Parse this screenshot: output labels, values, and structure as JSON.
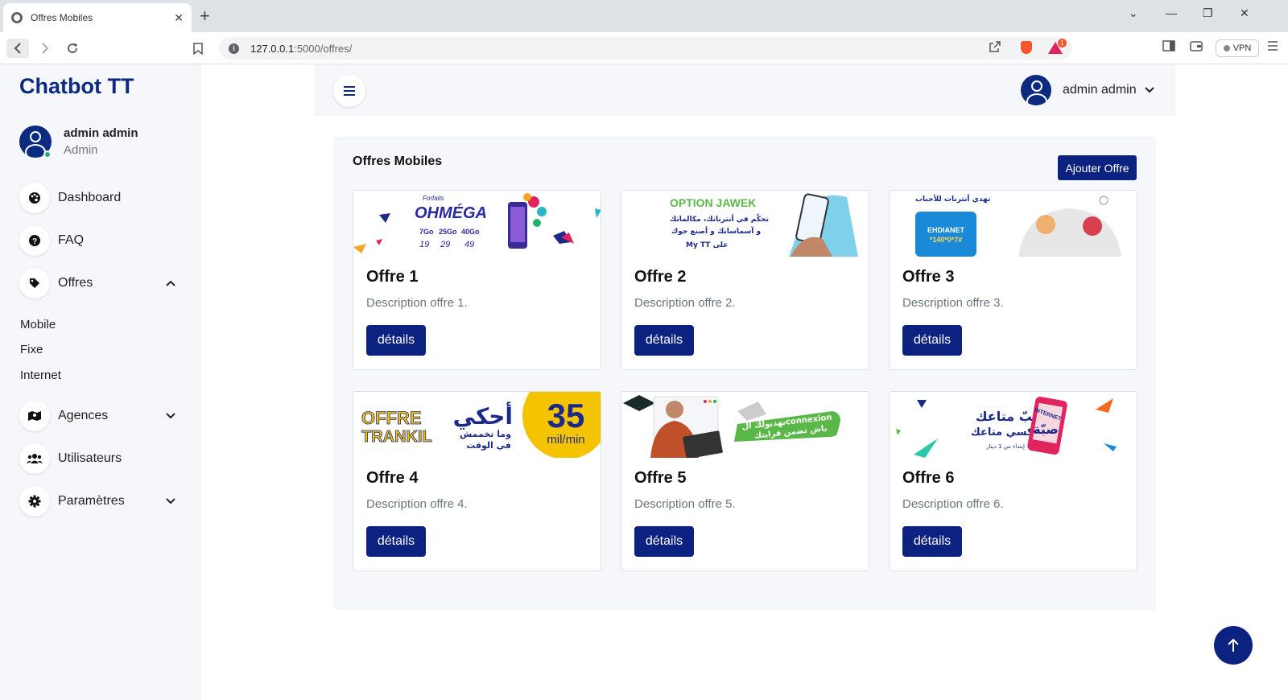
{
  "browser": {
    "tab_title": "Offres Mobiles",
    "tab_close": "✕",
    "new_tab": "+",
    "url_host": "127.0.0.1",
    "url_path": ":5000/offres/",
    "vpn_label": "VPN",
    "rewards_count": "1"
  },
  "sidebar": {
    "brand": "Chatbot TT",
    "user_name": "admin admin",
    "user_role": "Admin",
    "items": [
      {
        "label": "Dashboard",
        "icon": "palette-icon"
      },
      {
        "label": "FAQ",
        "icon": "question-circle-icon"
      },
      {
        "label": "Offres",
        "icon": "tag-icon"
      },
      {
        "label": "Agences",
        "icon": "map-icon"
      },
      {
        "label": "Utilisateurs",
        "icon": "users-icon"
      },
      {
        "label": "Paramètres",
        "icon": "gear-icon"
      }
    ],
    "offres_sub": [
      "Mobile",
      "Fixe",
      "Internet"
    ]
  },
  "topbar": {
    "user_name": "admin admin"
  },
  "page": {
    "title": "Offres Mobiles",
    "add_button": "Ajouter Offre"
  },
  "offers": [
    {
      "title": "Offre 1",
      "description": "Description offre 1.",
      "button": "détails",
      "banner": {
        "line1": "OHMÉGA",
        "line2": "Forfaits",
        "p1": "7Go",
        "p2": "25Go",
        "p3": "40Go",
        "v1": "19",
        "v2": "29",
        "v3": "49"
      }
    },
    {
      "title": "Offre 2",
      "description": "Description offre 2.",
      "button": "détails",
      "banner": {
        "line1": "OPTION JAWEK",
        "line2": "تحكّم في أنترناتك، مكالماتك",
        "line3": "و آسماساتك و أصنع جوك",
        "line4": "My TT على"
      }
    },
    {
      "title": "Offre 3",
      "description": "Description offre 3.",
      "button": "détails",
      "banner": {
        "line1": "نهدي أنترنات للأحباب",
        "line2": "EHDIANET",
        "line3": "*140*0*7#"
      }
    },
    {
      "title": "Offre 4",
      "description": "Description offre 4.",
      "button": "détails",
      "banner": {
        "line1": "OFFRE",
        "line2": "TRANKIL",
        "line3": "أحكي",
        "line4": "وما تخممش",
        "line5": "في الوقت",
        "big": "35",
        "unit": "mil/min"
      }
    },
    {
      "title": "Offre 5",
      "description": "Description offre 5.",
      "button": "détails",
      "banner": {
        "line1": "نهديولك الconnexion",
        "line2": "باش تضمن قرايتك"
      }
    },
    {
      "title": "Offre 6",
      "description": "Description offre 6.",
      "button": "détails",
      "banner": {
        "line1": "صبّ متاعك",
        "line2": "كونكسي متاعك",
        "line3": "INTERNET",
        "line4": "صبّة",
        "line5": "إبتداء من 1 دينار"
      }
    }
  ],
  "colors": {
    "primary": "#0c2280",
    "brand": "#0c2a80",
    "sidebar_bg": "#f5f7fa",
    "online": "#23b26d"
  }
}
